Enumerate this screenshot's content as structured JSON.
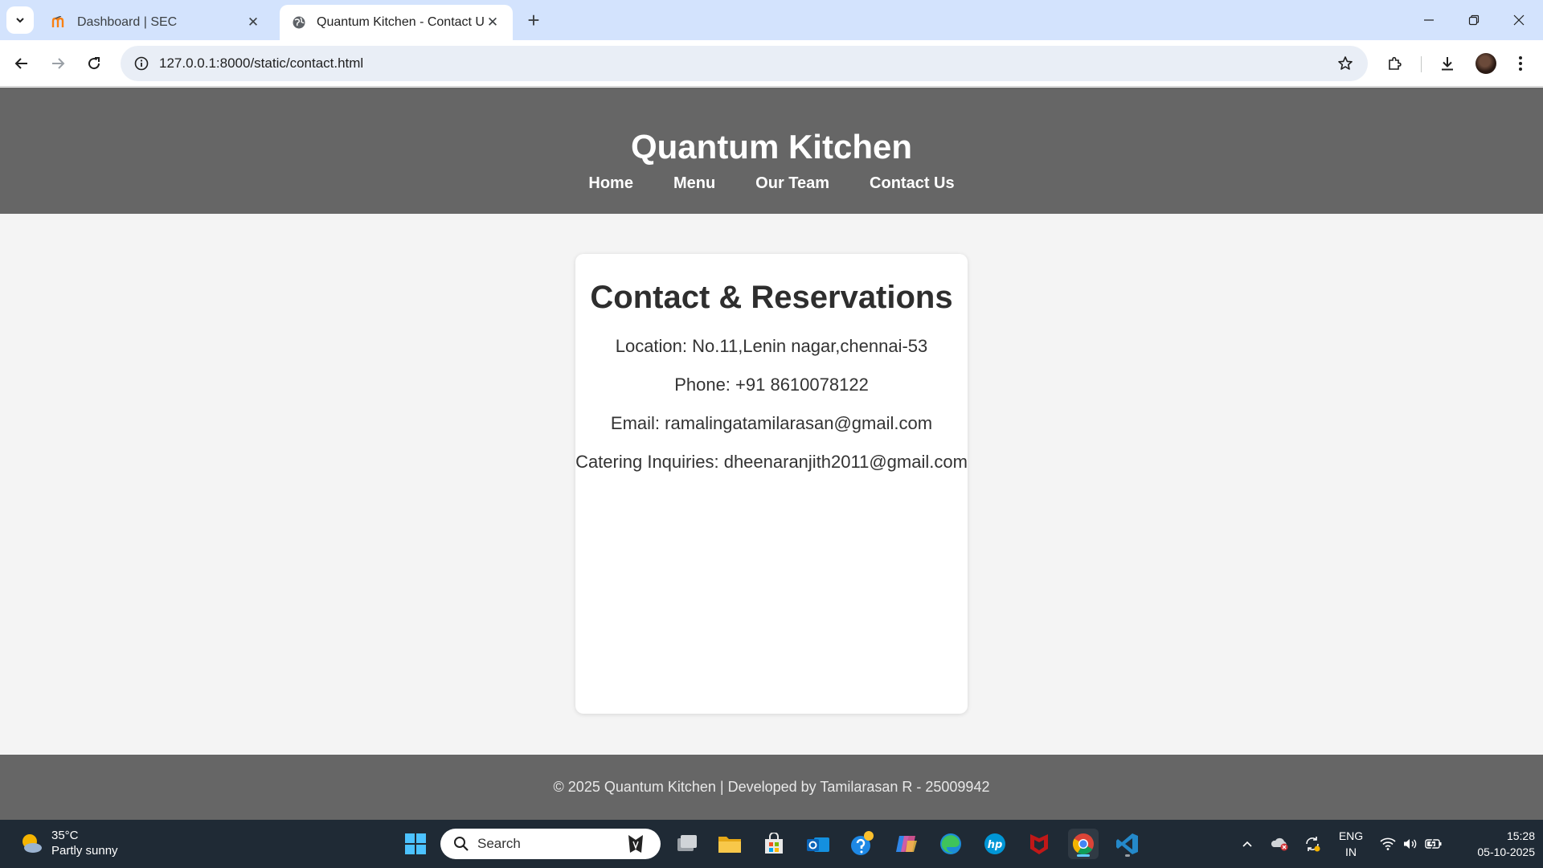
{
  "browser": {
    "tabs": [
      {
        "title": "Dashboard | SEC",
        "active": false,
        "favicon": "moodle-icon"
      },
      {
        "title": "Quantum Kitchen - Contact Us",
        "active": true,
        "favicon": "globe-icon"
      }
    ],
    "url": "127.0.0.1:8000/static/contact.html"
  },
  "site": {
    "title": "Quantum Kitchen",
    "nav": [
      "Home",
      "Menu",
      "Our Team",
      "Contact Us"
    ]
  },
  "contact": {
    "heading": "Contact & Reservations",
    "location": "Location: No.11,Lenin nagar,chennai-53",
    "phone": "Phone: +91 8610078122",
    "email": "Email: ramalingatamilarasan@gmail.com",
    "catering": "Catering Inquiries: dheenaranjith2011@gmail.com"
  },
  "footer": {
    "text": "© 2025 Quantum Kitchen | Developed by Tamilarasan R - 25009942"
  },
  "taskbar": {
    "weather_temp": "35°C",
    "weather_desc": "Partly sunny",
    "search_placeholder": "Search",
    "lang_line1": "ENG",
    "lang_line2": "IN",
    "time": "15:28",
    "date": "05-10-2025"
  },
  "colors": {
    "header_bg": "#666666",
    "tabstrip_bg": "#d3e3fd",
    "taskbar_bg": "#1f2a35"
  }
}
